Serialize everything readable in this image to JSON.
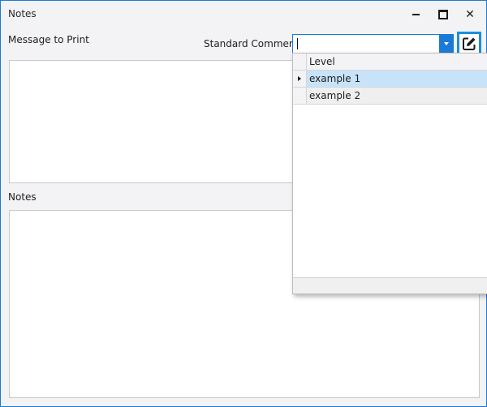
{
  "window": {
    "title": "Notes",
    "minimize_label": "—",
    "maximize_label": "☐",
    "close_label": "✕"
  },
  "form": {
    "message_label": "Message to Print",
    "standard_comment_label": "Standard Comment",
    "notes_label": "Notes",
    "standard_comment_value": ""
  },
  "dropdown": {
    "column_header": "Level",
    "rows": [
      {
        "value": "example 1",
        "selected": true
      },
      {
        "value": "example 2",
        "selected": false
      }
    ]
  },
  "colors": {
    "accent": "#1a7ad6",
    "selected_row": "#c7e3f9",
    "window_bg": "#f3f3f5"
  }
}
